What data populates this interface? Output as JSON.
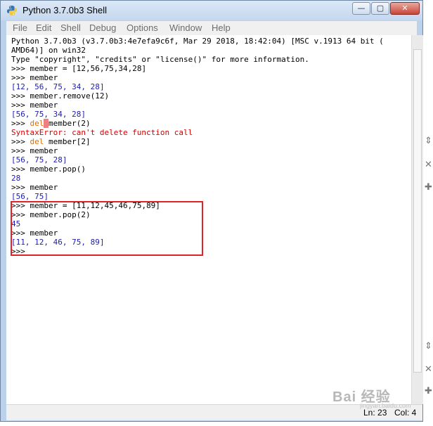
{
  "window": {
    "title": "Python 3.7.0b3 Shell",
    "controls": {
      "minimize": "—",
      "maximize": "▢",
      "close": "✕"
    }
  },
  "menu": [
    "File",
    "Edit",
    "Shell",
    "Debug",
    "Options",
    "Window",
    "Help"
  ],
  "shell": {
    "lines": [
      [
        {
          "t": "Python 3.7.0b3 (v3.7.0b3:4e7efa9c6f, Mar 29 2018, 18:42:04) [MSC v.1913 64 bit (",
          "c": "t"
        }
      ],
      [
        {
          "t": "AMD64)] on win32",
          "c": "t"
        }
      ],
      [
        {
          "t": "Type \"copyright\", \"credits\" or \"license()\" for more information.",
          "c": "t"
        }
      ],
      [
        {
          "t": ">>> ",
          "c": "t"
        },
        {
          "t": "member = [12,56,75,34,28]",
          "c": "t"
        }
      ],
      [
        {
          "t": ">>> ",
          "c": "t"
        },
        {
          "t": "member",
          "c": "t"
        }
      ],
      [
        {
          "t": "[12, 56, 75, 34, 28]",
          "c": "b"
        }
      ],
      [
        {
          "t": ">>> ",
          "c": "t"
        },
        {
          "t": "member.remove(12)",
          "c": "t"
        }
      ],
      [
        {
          "t": ">>> ",
          "c": "t"
        },
        {
          "t": "member",
          "c": "t"
        }
      ],
      [
        {
          "t": "[56, 75, 34, 28]",
          "c": "b"
        }
      ],
      [
        {
          "t": ">>> ",
          "c": "t"
        },
        {
          "t": "del",
          "c": "k"
        },
        {
          "t": " ",
          "c": "cursor"
        },
        {
          "t": "member(2)",
          "c": "t"
        }
      ],
      [
        {
          "t": "SyntaxError: can't delete function call",
          "c": "e"
        }
      ],
      [
        {
          "t": ">>> ",
          "c": "t"
        },
        {
          "t": "del",
          "c": "k"
        },
        {
          "t": " member[2]",
          "c": "t"
        }
      ],
      [
        {
          "t": ">>> ",
          "c": "t"
        },
        {
          "t": "member",
          "c": "t"
        }
      ],
      [
        {
          "t": "[56, 75, 28]",
          "c": "b"
        }
      ],
      [
        {
          "t": ">>> ",
          "c": "t"
        },
        {
          "t": "member.pop()",
          "c": "t"
        }
      ],
      [
        {
          "t": "28",
          "c": "b"
        }
      ],
      [
        {
          "t": ">>> ",
          "c": "t"
        },
        {
          "t": "member",
          "c": "t"
        }
      ],
      [
        {
          "t": "[56, 75]",
          "c": "b"
        }
      ],
      [
        {
          "t": ">>> ",
          "c": "t"
        },
        {
          "t": "member = [11,12,45,46,75,89]",
          "c": "t"
        }
      ],
      [
        {
          "t": ">>> ",
          "c": "t"
        },
        {
          "t": "member.pop(2)",
          "c": "t"
        }
      ],
      [
        {
          "t": "45",
          "c": "b"
        }
      ],
      [
        {
          "t": ">>> ",
          "c": "t"
        },
        {
          "t": "member",
          "c": "t"
        }
      ],
      [
        {
          "t": "[11, 12, 46, 75, 89]",
          "c": "b"
        }
      ],
      [
        {
          "t": ">>> ",
          "c": "t"
        }
      ]
    ]
  },
  "status": {
    "line": "Ln: 23",
    "col": "Col: 4"
  },
  "side_glyphs": [
    "⇕",
    "✕",
    "✚",
    "⇕",
    "✕",
    "✚"
  ],
  "watermark": {
    "main": "Bai 经验",
    "sub": "jingyan.baidu.com"
  },
  "colors": {
    "keyword": "#dd6e00",
    "output": "#1d1dad",
    "error": "#d40000",
    "highlight_box": "#e0232a"
  }
}
